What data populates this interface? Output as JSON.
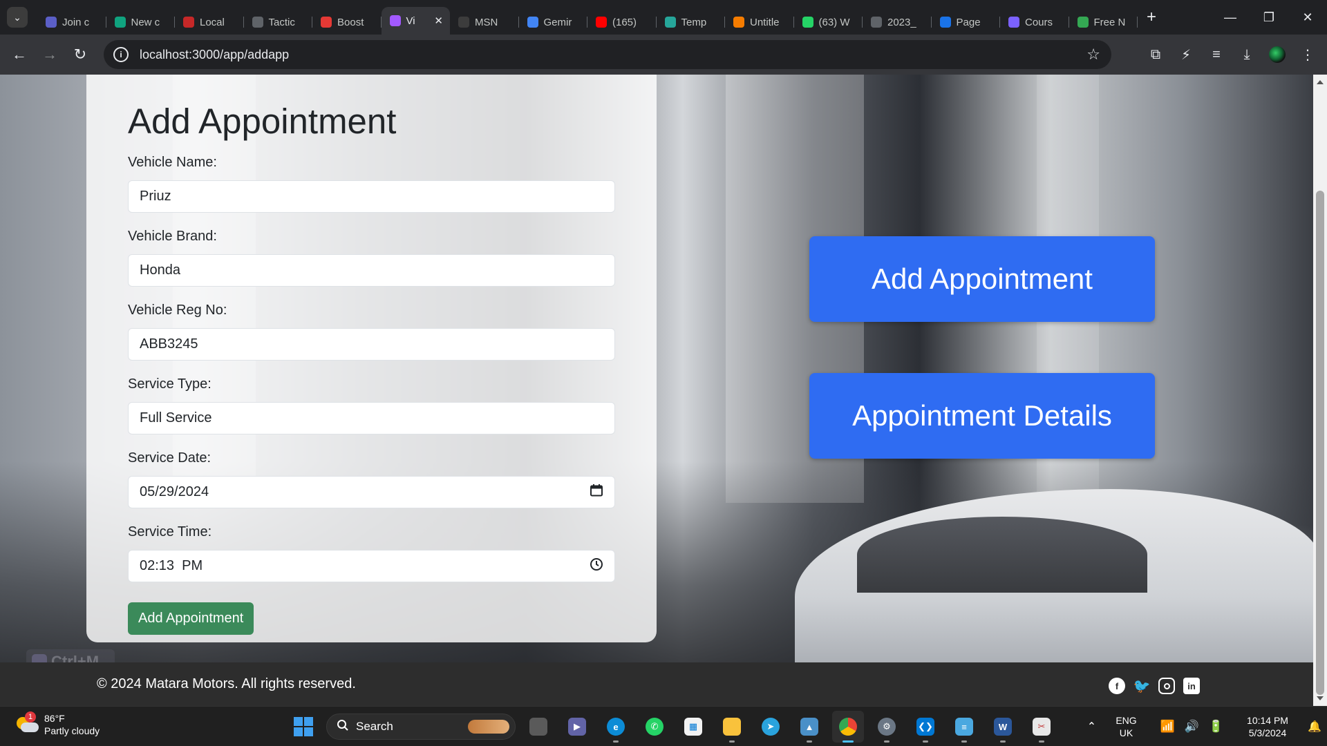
{
  "browser": {
    "tabs": [
      {
        "label": "Join c",
        "icon": "teams-icon",
        "color": "#5b5fc7"
      },
      {
        "label": "New c",
        "icon": "chatgpt-icon",
        "color": "#10a37f"
      },
      {
        "label": "Local",
        "icon": "local-icon",
        "color": "#c62828"
      },
      {
        "label": "Tactic",
        "icon": "globe-icon",
        "color": "#5f6368"
      },
      {
        "label": "Boost",
        "icon": "boost-icon",
        "color": "#e53935"
      },
      {
        "label": "Vi",
        "icon": "vite-icon",
        "color": "#a259ff",
        "active": true
      },
      {
        "label": "MSN",
        "icon": "msn-icon",
        "color": "#3c3c3c"
      },
      {
        "label": "Gemir",
        "icon": "gemini-icon",
        "color": "#4285f4"
      },
      {
        "label": "(165)",
        "icon": "youtube-icon",
        "color": "#ff0000"
      },
      {
        "label": "Temp",
        "icon": "temp-icon",
        "color": "#26a69a"
      },
      {
        "label": "Untitle",
        "icon": "untitled-icon",
        "color": "#f57c00"
      },
      {
        "label": "(63) W",
        "icon": "whatsapp-icon",
        "color": "#25d366"
      },
      {
        "label": "2023_",
        "icon": "globe-icon",
        "color": "#5f6368"
      },
      {
        "label": "Page",
        "icon": "page-icon",
        "color": "#1a73e8"
      },
      {
        "label": "Cours",
        "icon": "course-icon",
        "color": "#7b61ff"
      },
      {
        "label": "Free N",
        "icon": "free-icon",
        "color": "#34a853"
      }
    ],
    "url": "localhost:3000/app/addapp"
  },
  "form": {
    "title": "Add Appointment",
    "fields": [
      {
        "label": "Vehicle Name:",
        "value": "Priuz"
      },
      {
        "label": "Vehicle Brand:",
        "value": "Honda"
      },
      {
        "label": "Vehicle Reg No:",
        "value": "ABB3245"
      },
      {
        "label": "Service Type:",
        "value": "Full Service"
      },
      {
        "label": "Service Date:",
        "value": "05/29/2024",
        "icon": "calendar-icon"
      },
      {
        "label": "Service Time:",
        "value": "02:13  PM",
        "icon": "clock-icon"
      }
    ],
    "submit_label": "Add Appointment",
    "submit_color": "#3b8a5a"
  },
  "actions": {
    "add_label": "Add Appointment",
    "details_label": "Appointment Details",
    "color": "#2f6cf2"
  },
  "overlay": {
    "label": "Ctrl+M"
  },
  "footer": {
    "copyright": "© 2024 Matara Motors. All rights reserved.",
    "socials": [
      "facebook-icon",
      "twitter-icon",
      "instagram-icon",
      "linkedin-icon"
    ]
  },
  "taskbar": {
    "weather_temp": "86°F",
    "weather_desc": "Partly cloudy",
    "weather_badge": "1",
    "search_label": "Search",
    "lang_line1": "ENG",
    "lang_line2": "UK",
    "time": "10:14 PM",
    "date": "5/3/2024"
  }
}
